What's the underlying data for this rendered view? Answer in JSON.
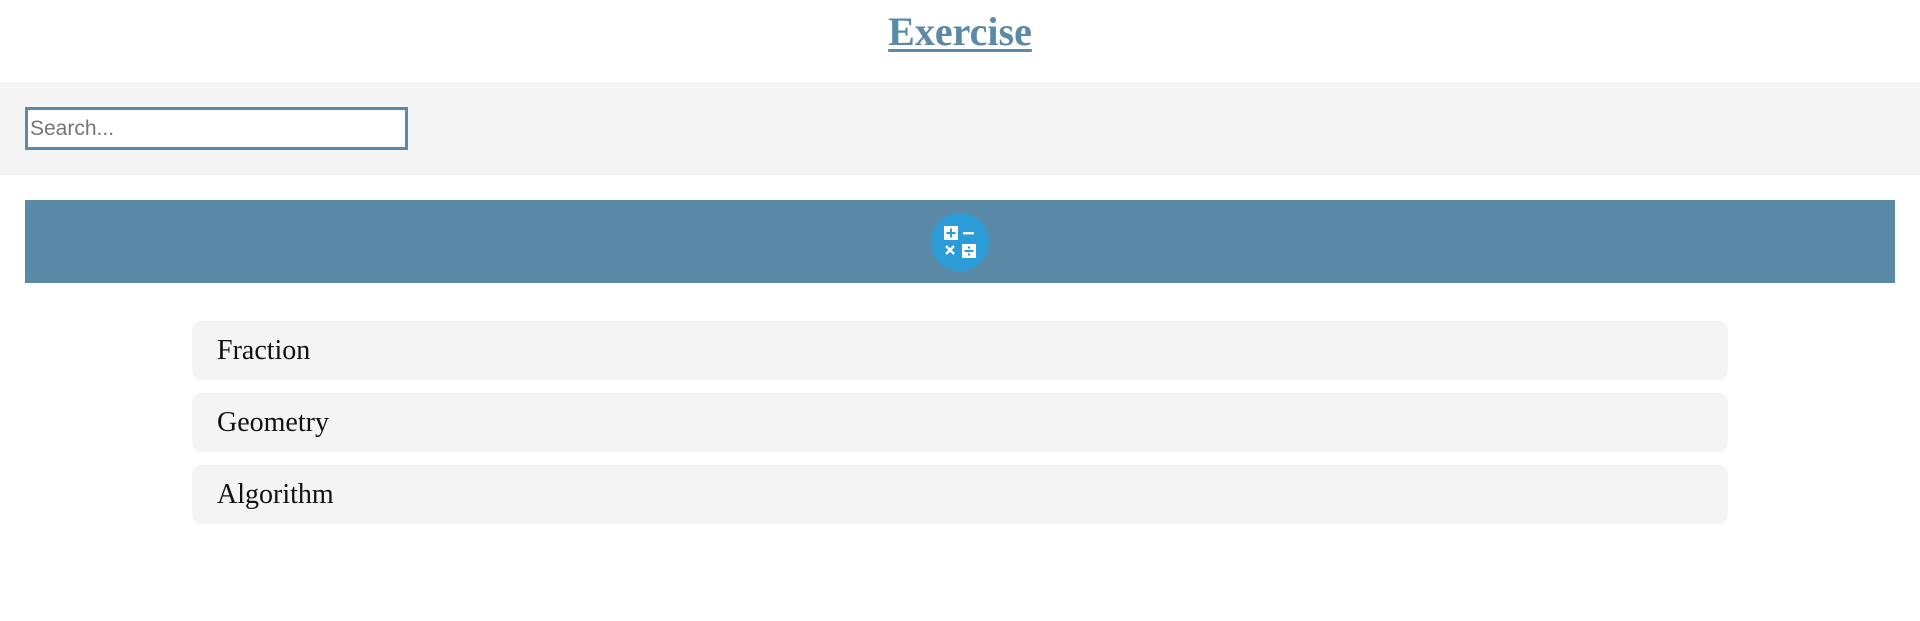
{
  "header": {
    "title": "Exercise"
  },
  "search": {
    "placeholder": "Search...",
    "value": ""
  },
  "banner": {
    "icon": "calculator-icon",
    "color": "#5b8aa8",
    "icon_bg": "#2b9cd8"
  },
  "topics": [
    {
      "label": "Fraction"
    },
    {
      "label": "Geometry"
    },
    {
      "label": "Algorithm"
    }
  ]
}
